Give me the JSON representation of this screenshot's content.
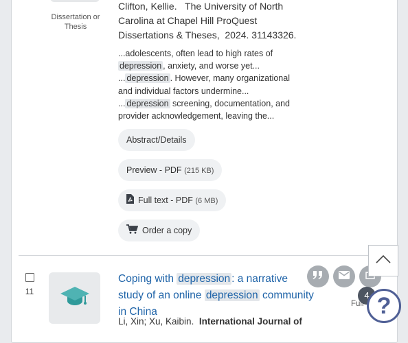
{
  "result1": {
    "doctype": "Dissertation or Thesis",
    "citation": {
      "authors": "Clifton, Kellie.",
      "publication": "The University of North Carolina at Chapel Hill ProQuest Dissertations & Theses,",
      "year_id": "2024. 31143326."
    },
    "snippet": {
      "s1": "...adolescents, often lead to high rates of ",
      "hl1": "depression",
      "s2": ", anxiety, and worse yet...",
      "s3": "...",
      "hl2": "depression",
      "s4": ". However, many organizational and individual factors undermine...",
      "s5": "...",
      "hl3": "depression",
      "s6": " screening, documentation, and provider acknowledgement, leaving the..."
    },
    "links": {
      "abstract": "Abstract/Details",
      "preview": "Preview - PDF",
      "preview_size": "(215 KB)",
      "fulltext": "Full text - PDF",
      "fulltext_size": "(6 MB)",
      "order": "Order a copy"
    }
  },
  "result2": {
    "number": "11",
    "title": {
      "t1": "Coping with ",
      "hl1": "depression",
      "t2": ": a narrative study of an online ",
      "hl2": "depression",
      "t3": " community in China"
    },
    "authors": "Li, Xin; Xu, Kaibin.",
    "journal": "International Journal of",
    "full_label": "Full"
  },
  "widgets": {
    "badge_count": "4",
    "help_label": "?"
  },
  "colors": {
    "link": "#1e63a8",
    "highlight": "#e4e7ea",
    "help_ring": "#4f5f95"
  }
}
